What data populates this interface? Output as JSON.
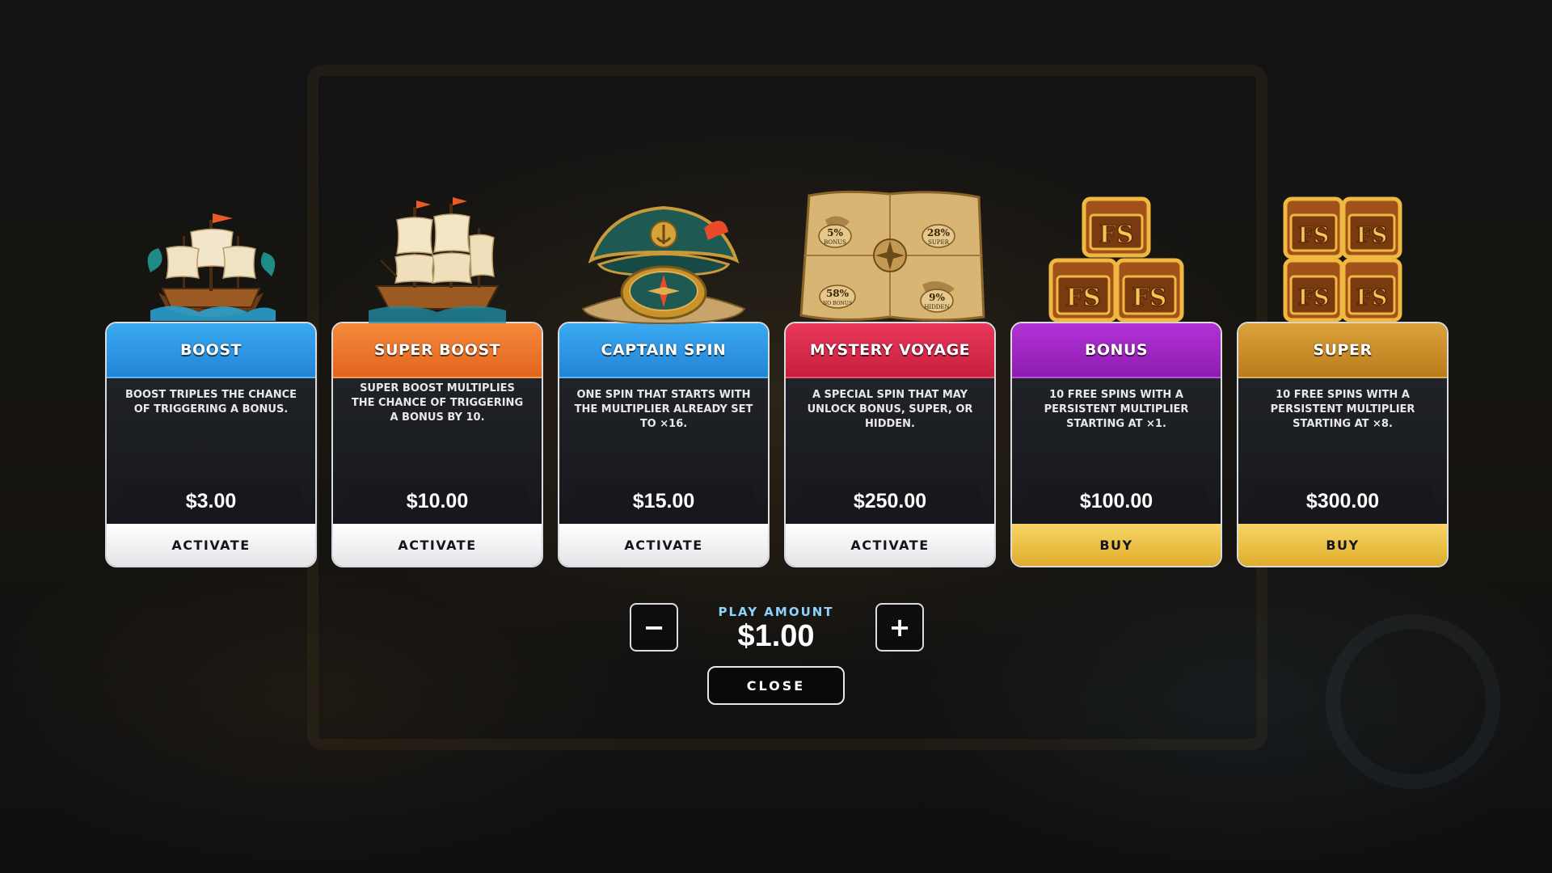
{
  "play_amount": {
    "label": "PLAY AMOUNT",
    "value": "$1.00",
    "decrease_symbol": "−",
    "increase_symbol": "+"
  },
  "close_label": "CLOSE",
  "cards": [
    {
      "title": "BOOST",
      "description": "BOOST TRIPLES THE CHANCE OF TRIGGERING A BONUS.",
      "price": "$3.00",
      "button": "ACTIVATE",
      "icon": "pirate-ship-icon",
      "header_color": "#2f9ae8"
    },
    {
      "title": "SUPER BOOST",
      "description": "SUPER BOOST MULTIPLIES THE CHANCE OF TRIGGERING A BONUS BY 10.",
      "price": "$10.00",
      "button": "ACTIVATE",
      "icon": "galleon-icon",
      "header_color": "#f0782a"
    },
    {
      "title": "CAPTAIN SPIN",
      "description": "ONE SPIN THAT STARTS WITH THE MULTIPLIER ALREADY SET TO ×16.",
      "price": "$15.00",
      "button": "ACTIVATE",
      "icon": "captain-hat-compass-icon",
      "header_color": "#2f9ae8"
    },
    {
      "title": "MYSTERY VOYAGE",
      "description": "A SPECIAL SPIN THAT MAY UNLOCK BONUS, SUPER, OR HIDDEN.",
      "price": "$250.00",
      "button": "ACTIVATE",
      "icon": "treasure-map-icon",
      "header_color": "#d92a4a",
      "map_labels": [
        "5%",
        "BONUS",
        "28%",
        "SUPER",
        "58%",
        "NO BONUS",
        "9%",
        "HIDDEN"
      ]
    },
    {
      "title": "BONUS",
      "description": "10 FREE SPINS WITH A PERSISTENT MULTIPLIER STARTING AT ×1.",
      "price": "$100.00",
      "button": "BUY",
      "icon": "fs-chests-three-icon",
      "header_color": "#a324c4",
      "chest_label": "FS"
    },
    {
      "title": "SUPER",
      "description": "10 FREE SPINS WITH A PERSISTENT MULTIPLIER STARTING AT ×8.",
      "price": "$300.00",
      "button": "BUY",
      "icon": "fs-chests-four-icon",
      "header_color": "#d89a2a",
      "chest_label": "FS"
    }
  ]
}
